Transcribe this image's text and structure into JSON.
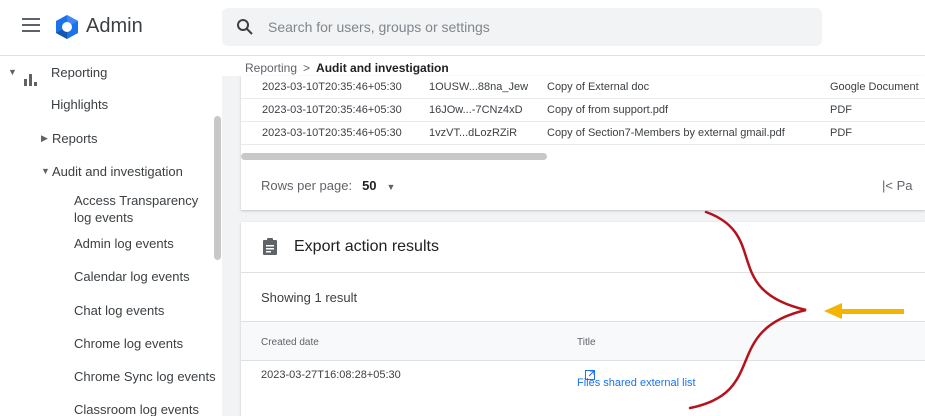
{
  "header": {
    "app_title": "Admin",
    "search_placeholder": "Search for users, groups or settings"
  },
  "sidebar": {
    "reporting": "Reporting",
    "highlights": "Highlights",
    "reports": "Reports",
    "audit": "Audit and investigation",
    "items": [
      "Access Transparency log events",
      "Admin log events",
      "Calendar log events",
      "Chat log events",
      "Chrome log events",
      "Chrome Sync log events",
      "Classroom log events"
    ]
  },
  "breadcrumb": {
    "parent": "Reporting",
    "separator": ">",
    "current": "Audit and investigation"
  },
  "files_table": {
    "rows": [
      {
        "date": "2023-03-10T20:35:46+05:30",
        "id": "1OUSW...88na_Jew",
        "title": "Copy of External doc",
        "type": "Google Document"
      },
      {
        "date": "2023-03-10T20:35:46+05:30",
        "id": "16JOw...-7CNz4xD",
        "title": "Copy of from support.pdf",
        "type": "PDF"
      },
      {
        "date": "2023-03-10T20:35:46+05:30",
        "id": "1vzVT...dLozRZiR",
        "title": "Copy of Section7-Members by external gmail.pdf",
        "type": "PDF"
      }
    ],
    "rows_per_page_label": "Rows per page:",
    "rows_per_page_value": "50",
    "pager_text": "|< Pa"
  },
  "export": {
    "title": "Export action results",
    "showing": "Showing 1 result",
    "col_created": "Created date",
    "col_title": "Title",
    "row": {
      "created": "2023-03-27T16:08:28+05:30",
      "title": "Files shared external list"
    }
  },
  "colors": {
    "accent": "#1a73e8",
    "annotation_bracket": "#b5121b",
    "annotation_arrow": "#f4b400"
  }
}
